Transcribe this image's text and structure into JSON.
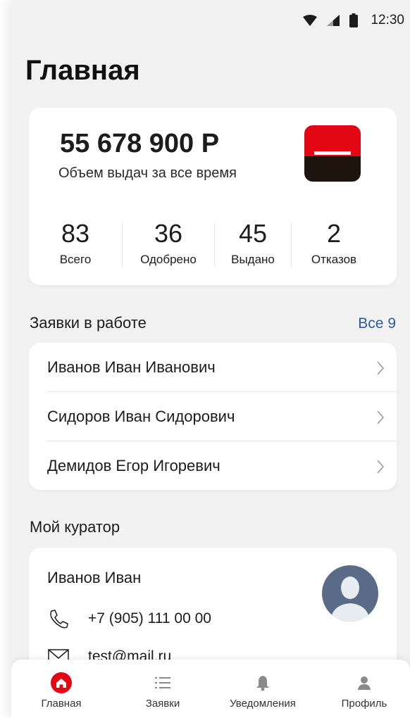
{
  "status_bar": {
    "time": "12:30"
  },
  "page_title": "Главная",
  "summary": {
    "amount": "55 678 900 Р",
    "amount_label": "Объем выдач за все время",
    "stats": [
      {
        "value": "83",
        "label": "Всего"
      },
      {
        "value": "36",
        "label": "Одобрено"
      },
      {
        "value": "45",
        "label": "Выдано"
      },
      {
        "value": "2",
        "label": "Отказов"
      }
    ],
    "logo_colors": {
      "top": "#e30613",
      "bottom": "#1f130d"
    }
  },
  "requests": {
    "title": "Заявки в работе",
    "all_link": "Все 9",
    "items": [
      {
        "name": "Иванов Иван Иванович"
      },
      {
        "name": "Сидоров Иван Сидорович"
      },
      {
        "name": "Демидов Егор Игоревич"
      }
    ]
  },
  "curator": {
    "title": "Мой куратор",
    "name": "Иванов Иван",
    "phone": "+7 (905) 111 00 00",
    "email": "test@mail.ru"
  },
  "tabs": [
    {
      "label": "Главная",
      "icon": "home-icon",
      "active": true
    },
    {
      "label": "Заявки",
      "icon": "list-icon",
      "active": false
    },
    {
      "label": "Уведомления",
      "icon": "bell-icon",
      "active": false
    },
    {
      "label": "Профиль",
      "icon": "user-icon",
      "active": false
    }
  ],
  "colors": {
    "accent": "#e30613",
    "link": "#2b5aa0",
    "background": "#f2f2f2"
  }
}
